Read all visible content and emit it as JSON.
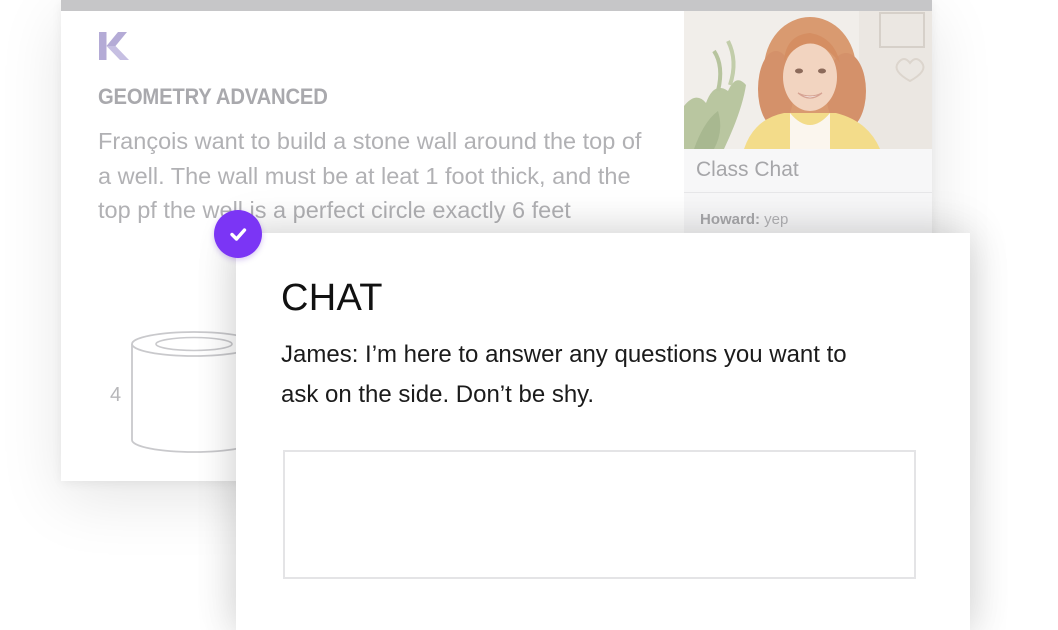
{
  "lesson": {
    "title": "GEOMETRY ADVANCED",
    "body": "François want to build a stone wall around the top of a well. The wall must be at leat 1 foot thick, and the top pf the well is a perfect circle exactly 6 feet",
    "figure_label": "4"
  },
  "sidebar": {
    "class_chat_title": "Class Chat",
    "messages": [
      {
        "author": "Howard:",
        "text": " yep"
      }
    ]
  },
  "chat": {
    "title": "CHAT",
    "message": "James: I’m here to answer any questions you want to ask on the side. Don’t be shy.",
    "input_value": "",
    "input_placeholder": ""
  },
  "colors": {
    "accent": "#7b35f5",
    "logo": "#b4abd6"
  },
  "icons": {
    "logo": "k-logo-icon",
    "badge": "checkmark-icon"
  }
}
